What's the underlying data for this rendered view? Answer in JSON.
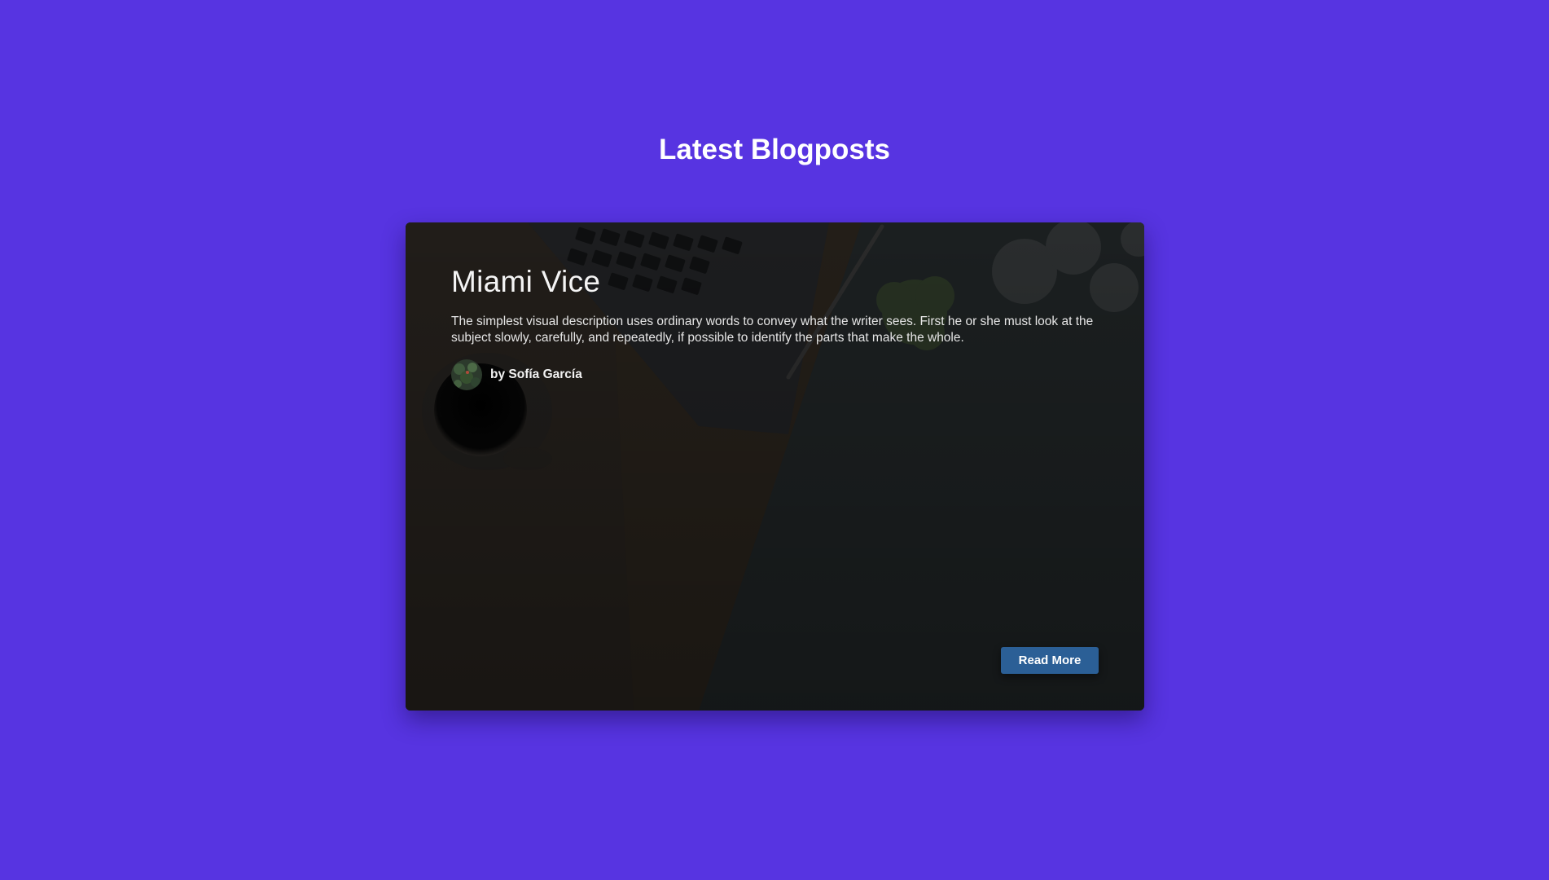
{
  "section": {
    "title": "Latest Blogposts"
  },
  "post": {
    "title": "Miami Vice",
    "excerpt": "The simplest visual description uses ordinary words to convey what the writer sees. First he or she must look at the subject slowly, carefully, and repeatedly, if possible to identify the parts that make the whole.",
    "author": "by Sofía García",
    "read_more_label": "Read More"
  },
  "colors": {
    "page_background": "#5734e1",
    "card_background": "#1b1d1e",
    "button_background": "#2b5f96",
    "text": "#ffffff"
  }
}
